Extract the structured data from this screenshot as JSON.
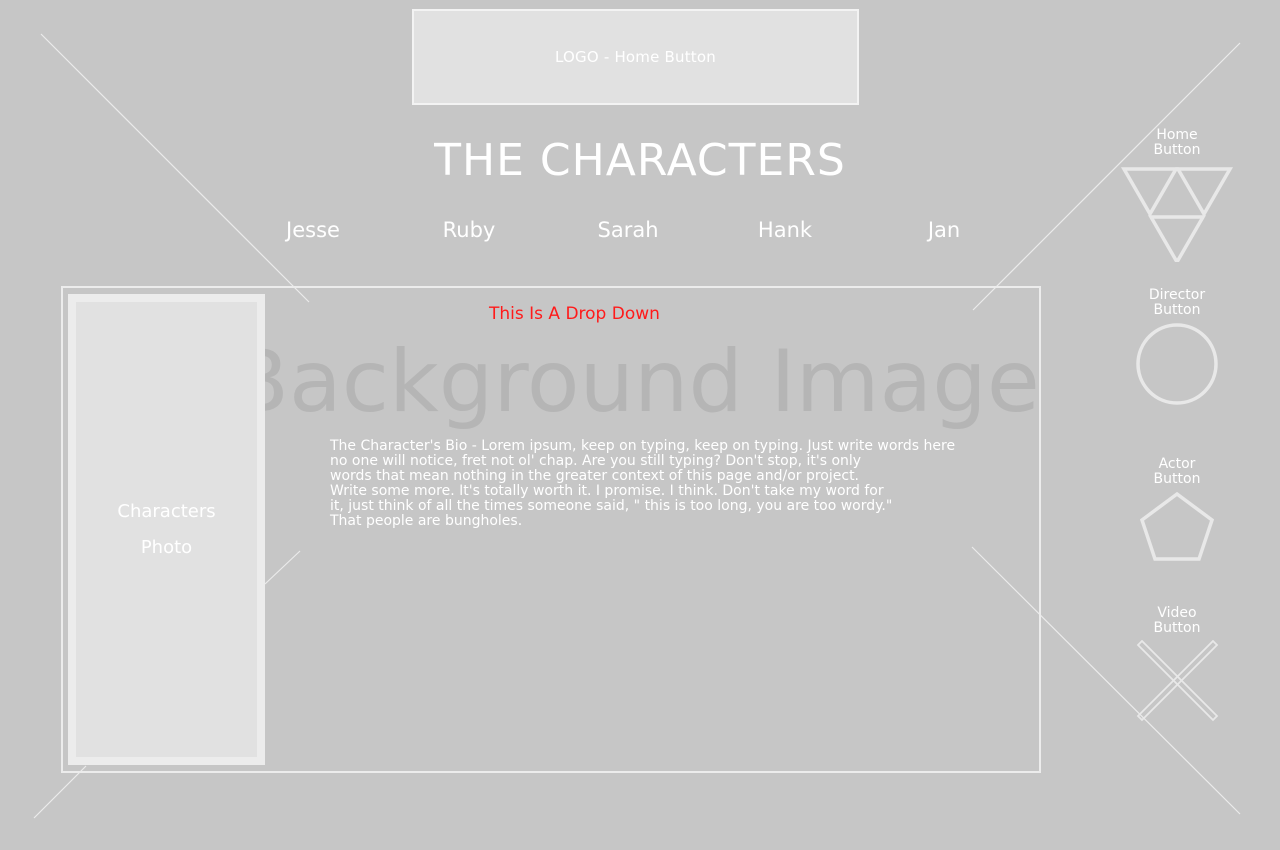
{
  "header": {
    "logo_label": "LOGO - Home Button",
    "page_title": "THE CHARACTERS"
  },
  "characters": {
    "nav": [
      "Jesse",
      "Ruby",
      "Sarah",
      "Hank",
      "Jan"
    ]
  },
  "content": {
    "photo_label_line1": "Characters",
    "photo_label_line2": "Photo",
    "dropdown_label": "This Is A Drop Down",
    "background_label": "Background Image",
    "bio_lines": [
      "The Character's Bio - Lorem ipsum, keep on typing, keep on typing. Just write words here",
      "no one will notice, fret not ol' chap. Are you still typing? Don't stop, it's only",
      "words that mean nothing in the greater context of this page and/or project.",
      "Write some more. It's totally worth it. I promise. I think. Don't take my word for",
      "it, just think of all the times someone said, \" this is too long, you are too wordy.\"",
      "That people are bungholes."
    ]
  },
  "side_nav": {
    "home": {
      "line1": "Home",
      "line2": "Button",
      "icon": "triangles-icon"
    },
    "director": {
      "line1": "Director",
      "line2": "Button",
      "icon": "circle-icon"
    },
    "actor": {
      "line1": "Actor",
      "line2": "Button",
      "icon": "pentagon-icon"
    },
    "video": {
      "line1": "Video",
      "line2": "Button",
      "icon": "x-icon"
    }
  },
  "colors": {
    "background": "#c6c6c6",
    "panel": "#e1e1e1",
    "dropdown_text": "#ff1a1a",
    "watermark_text": "#b5b5b5"
  }
}
